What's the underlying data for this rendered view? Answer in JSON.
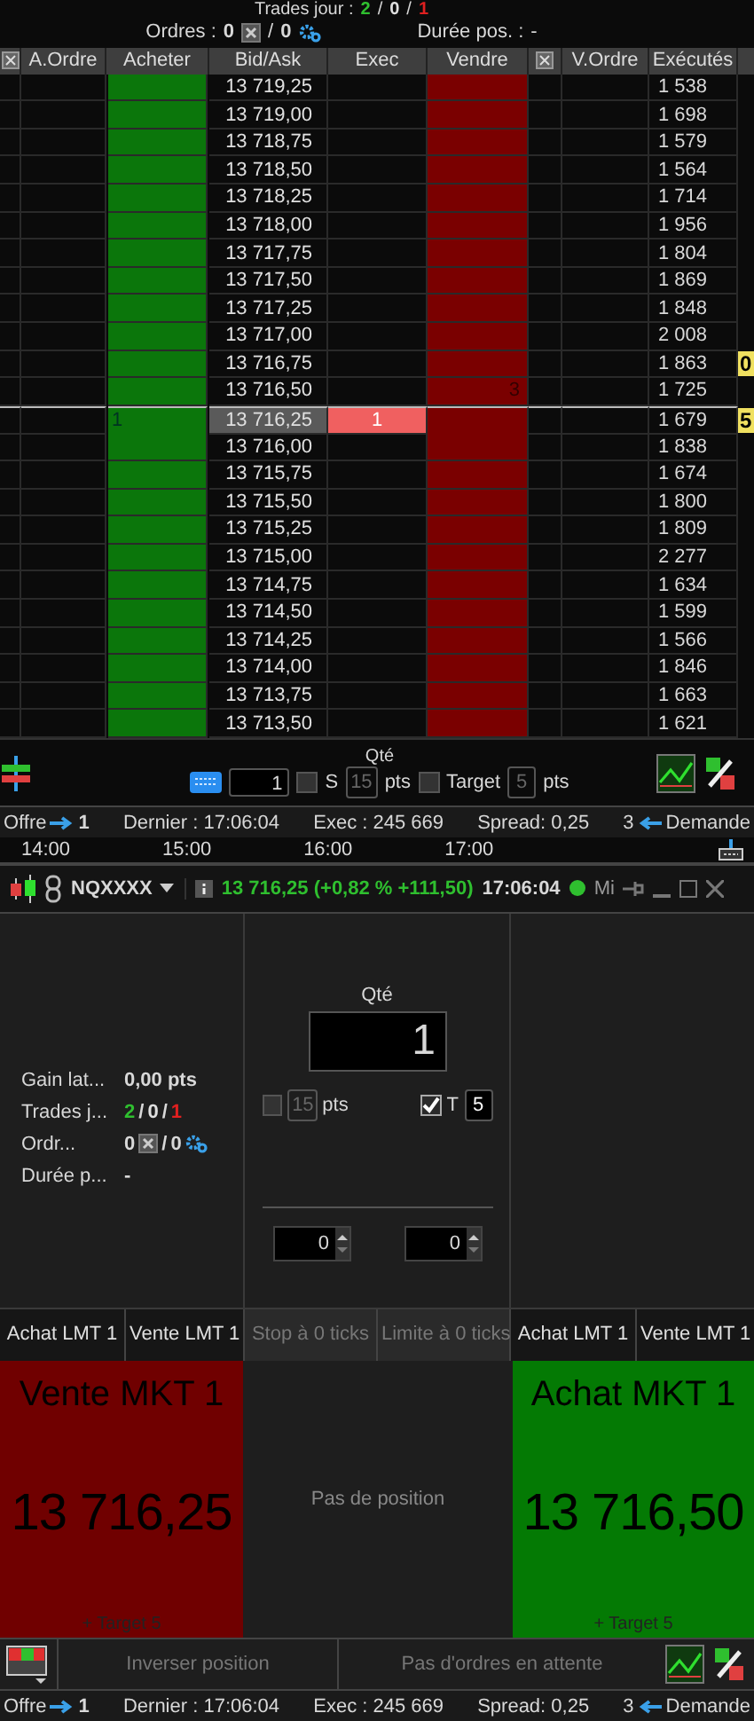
{
  "top_stats": {
    "trades_label": "Trades jour :",
    "trades_separator": "/",
    "trades": [
      {
        "value": "2",
        "color": "#2fbf2f"
      },
      {
        "value": "0",
        "color": "#e0e0e0"
      },
      {
        "value": "1",
        "color": "#e02020"
      }
    ],
    "orders_label": "Ordres :",
    "orders_pending": "0",
    "orders_separator": "/",
    "orders_total": "0",
    "duration_label": "Durée pos. :",
    "duration": "-"
  },
  "ladder": {
    "columns": [
      {
        "kind": "icon"
      },
      {
        "kind": "text",
        "label": "A.Ordre"
      },
      {
        "kind": "text",
        "label": "Acheter"
      },
      {
        "kind": "text",
        "label": "Bid/Ask"
      },
      {
        "kind": "text",
        "label": "Exec"
      },
      {
        "kind": "text",
        "label": "Vendre"
      },
      {
        "kind": "icon"
      },
      {
        "kind": "text",
        "label": "V.Ordre"
      },
      {
        "kind": "text",
        "label": "Exécutés"
      }
    ],
    "rows": [
      {
        "price": "13 719,25",
        "executed": "1 538",
        "selected": false
      },
      {
        "price": "13 719,00",
        "executed": "1 698",
        "selected": false
      },
      {
        "price": "13 718,75",
        "executed": "1 579",
        "selected": false
      },
      {
        "price": "13 718,50",
        "executed": "1 564",
        "selected": false
      },
      {
        "price": "13 718,25",
        "executed": "1 714",
        "selected": false
      },
      {
        "price": "13 718,00",
        "executed": "1 956",
        "selected": false
      },
      {
        "price": "13 717,75",
        "executed": "1 804",
        "selected": false
      },
      {
        "price": "13 717,50",
        "executed": "1 869",
        "selected": false
      },
      {
        "price": "13 717,25",
        "executed": "1 848",
        "selected": false
      },
      {
        "price": "13 717,00",
        "executed": "2 008",
        "selected": false
      },
      {
        "price": "13 716,75",
        "executed": "1 863",
        "selected": false,
        "marker": "0"
      },
      {
        "price": "13 716,50",
        "executed": "1 725",
        "selected": false,
        "sell": "3"
      },
      {
        "price": "13 716,25",
        "executed": "1 679",
        "selected": true,
        "buy": "1",
        "exec": "1",
        "marker": "5"
      },
      {
        "price": "13 716,00",
        "executed": "1 838",
        "selected": false
      },
      {
        "price": "13 715,75",
        "executed": "1 674",
        "selected": false
      },
      {
        "price": "13 715,50",
        "executed": "1 800",
        "selected": false
      },
      {
        "price": "13 715,25",
        "executed": "1 809",
        "selected": false
      },
      {
        "price": "13 715,00",
        "executed": "2 277",
        "selected": false
      },
      {
        "price": "13 714,75",
        "executed": "1 634",
        "selected": false
      },
      {
        "price": "13 714,50",
        "executed": "1 599",
        "selected": false
      },
      {
        "price": "13 714,25",
        "executed": "1 566",
        "selected": false
      },
      {
        "price": "13 714,00",
        "executed": "1 846",
        "selected": false
      },
      {
        "price": "13 713,75",
        "executed": "1 663",
        "selected": false
      },
      {
        "price": "13 713,50",
        "executed": "1 621",
        "selected": false
      }
    ]
  },
  "order_bar": {
    "qty_label": "Qté",
    "qty": "1",
    "stop_label": "S",
    "stop_checked": false,
    "stop_value": "15",
    "stop_unit": "pts",
    "target_label": "Target",
    "target_checked": false,
    "target_value": "5",
    "target_unit": "pts"
  },
  "status_bar_top": {
    "offer_label": "Offre",
    "offer_qty": "1",
    "last": "Dernier : 17:06:04",
    "exec": "Exec : 245 669",
    "spread": "Spread: 0,25",
    "ask_qty": "3",
    "ask_label": "Demande"
  },
  "time_axis": [
    "14:00",
    "15:00",
    "16:00",
    "17:00"
  ],
  "window": {
    "symbol": "NQXXXX",
    "quote": "13 716,25 (+0,82 % +111,50)",
    "time": "17:06:04",
    "feed": "Mi"
  },
  "position_stats": [
    {
      "label": "Gain lat...",
      "value": "0,00 pts",
      "kind": "text"
    },
    {
      "label": "Trades j...",
      "kind": "trades",
      "separator": "/",
      "values": [
        {
          "value": "2",
          "color": "#2fbf2f"
        },
        {
          "value": "0",
          "color": "#e0e0e0"
        },
        {
          "value": "1",
          "color": "#e02020"
        }
      ]
    },
    {
      "label": "Ordr...",
      "kind": "orders",
      "pending": "0",
      "separator": "/",
      "total": "0"
    },
    {
      "label": "Durée p...",
      "value": "-",
      "kind": "text"
    }
  ],
  "trade_panel": {
    "qty_label": "Qté",
    "qty": "1",
    "stop_checked": false,
    "stop_value": "15",
    "stop_unit": "pts",
    "target_checked": true,
    "target_label": "T",
    "target_value": "5",
    "spinners": [
      "0",
      "0"
    ]
  },
  "limit_buttons": [
    {
      "label": "Achat LMT 1",
      "disabled": false
    },
    {
      "label": "Vente LMT 1",
      "disabled": false
    },
    {
      "label": "Stop à 0 ticks",
      "disabled": true
    },
    {
      "label": "Limite à 0 ticks",
      "disabled": true
    },
    {
      "label": "Achat LMT 1",
      "disabled": false
    },
    {
      "label": "Vente LMT 1",
      "disabled": false
    }
  ],
  "sell_market": {
    "label": "Vente MKT 1",
    "price": "13 716,25",
    "target": "+ Target 5"
  },
  "position_text": "Pas de position",
  "buy_market": {
    "label": "Achat MKT 1",
    "price": "13 716,50",
    "target": "+ Target 5"
  },
  "bottom_actions": [
    {
      "label": "Inverser position",
      "disabled": true
    },
    {
      "label": "Pas d'ordres en attente",
      "disabled": true
    }
  ],
  "status_bar_bottom": {
    "offer_label": "Offre",
    "offer_qty": "1",
    "last": "Dernier : 17:06:04",
    "exec": "Exec : 245 669",
    "spread": "Spread: 0,25",
    "ask_qty": "3",
    "ask_label": "Demande"
  }
}
